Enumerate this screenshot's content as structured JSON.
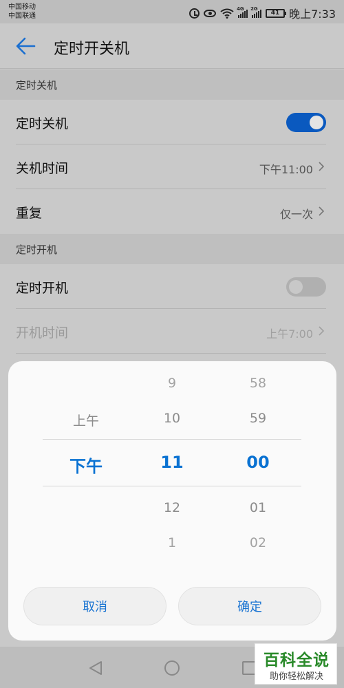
{
  "status_bar": {
    "carrier_1": "中国移动",
    "carrier_2": "中国联通",
    "signal_tag_1": "4G",
    "signal_tag_2": "2G",
    "battery": "41",
    "time": "晚上7:33"
  },
  "app_bar": {
    "title": "定时开关机"
  },
  "sections": [
    {
      "header": "定时关机",
      "rows": [
        {
          "label": "定时关机",
          "toggle_on": true
        },
        {
          "label": "关机时间",
          "value": "下午11:00"
        },
        {
          "label": "重复",
          "value": "仅一次"
        }
      ]
    },
    {
      "header": "定时开机",
      "rows": [
        {
          "label": "定时开机",
          "toggle_on": false
        },
        {
          "label": "开机时间",
          "value": "上午7:00"
        }
      ]
    }
  ],
  "time_picker": {
    "period": {
      "above": "上午",
      "selected": "下午"
    },
    "hour": {
      "above2": "9",
      "above1": "10",
      "selected": "11",
      "below1": "12",
      "below2": "1"
    },
    "minute": {
      "above2": "58",
      "above1": "59",
      "selected": "00",
      "below1": "01",
      "below2": "02"
    },
    "cancel_label": "取消",
    "confirm_label": "确定"
  },
  "watermark": {
    "title": "百科全说",
    "subtitle": "助你轻松解决"
  },
  "colors": {
    "accent": "#0a72d2",
    "toggle_on": "#0a59bf",
    "watermark_green": "#2a8a2a"
  }
}
